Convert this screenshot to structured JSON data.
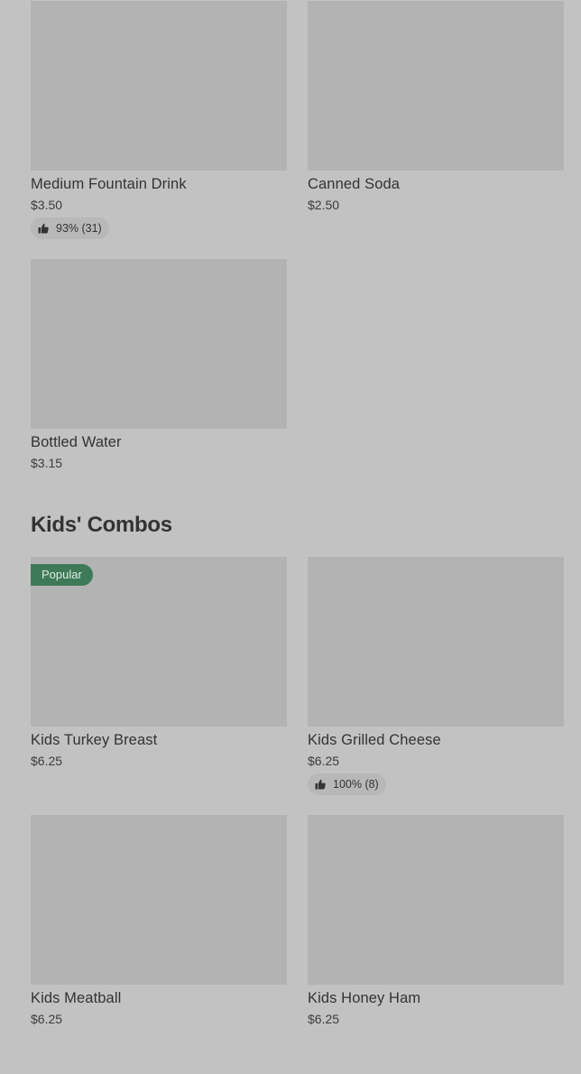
{
  "drinks": {
    "items": [
      {
        "name": "Medium Fountain Drink",
        "price": "$3.50",
        "rating": "93% (31)"
      },
      {
        "name": "Canned Soda",
        "price": "$2.50"
      },
      {
        "name": "Bottled Water",
        "price": "$3.15"
      }
    ]
  },
  "kids_combos": {
    "title": "Kids' Combos",
    "badge_label": "Popular",
    "items": [
      {
        "name": "Kids Turkey Breast",
        "price": "$6.25"
      },
      {
        "name": "Kids Grilled Cheese",
        "price": "$6.25",
        "rating": "100% (8)"
      },
      {
        "name": "Kids Meatball",
        "price": "$6.25"
      },
      {
        "name": "Kids Honey Ham",
        "price": "$6.25"
      }
    ]
  },
  "colors": {
    "page_background": "#c2c2c2",
    "image_placeholder": "#b3b3b3",
    "popular_badge": "#3f7a58",
    "rating_chip": "#b8b8b8"
  },
  "icons": {
    "rating": "thumbs-up-icon"
  }
}
